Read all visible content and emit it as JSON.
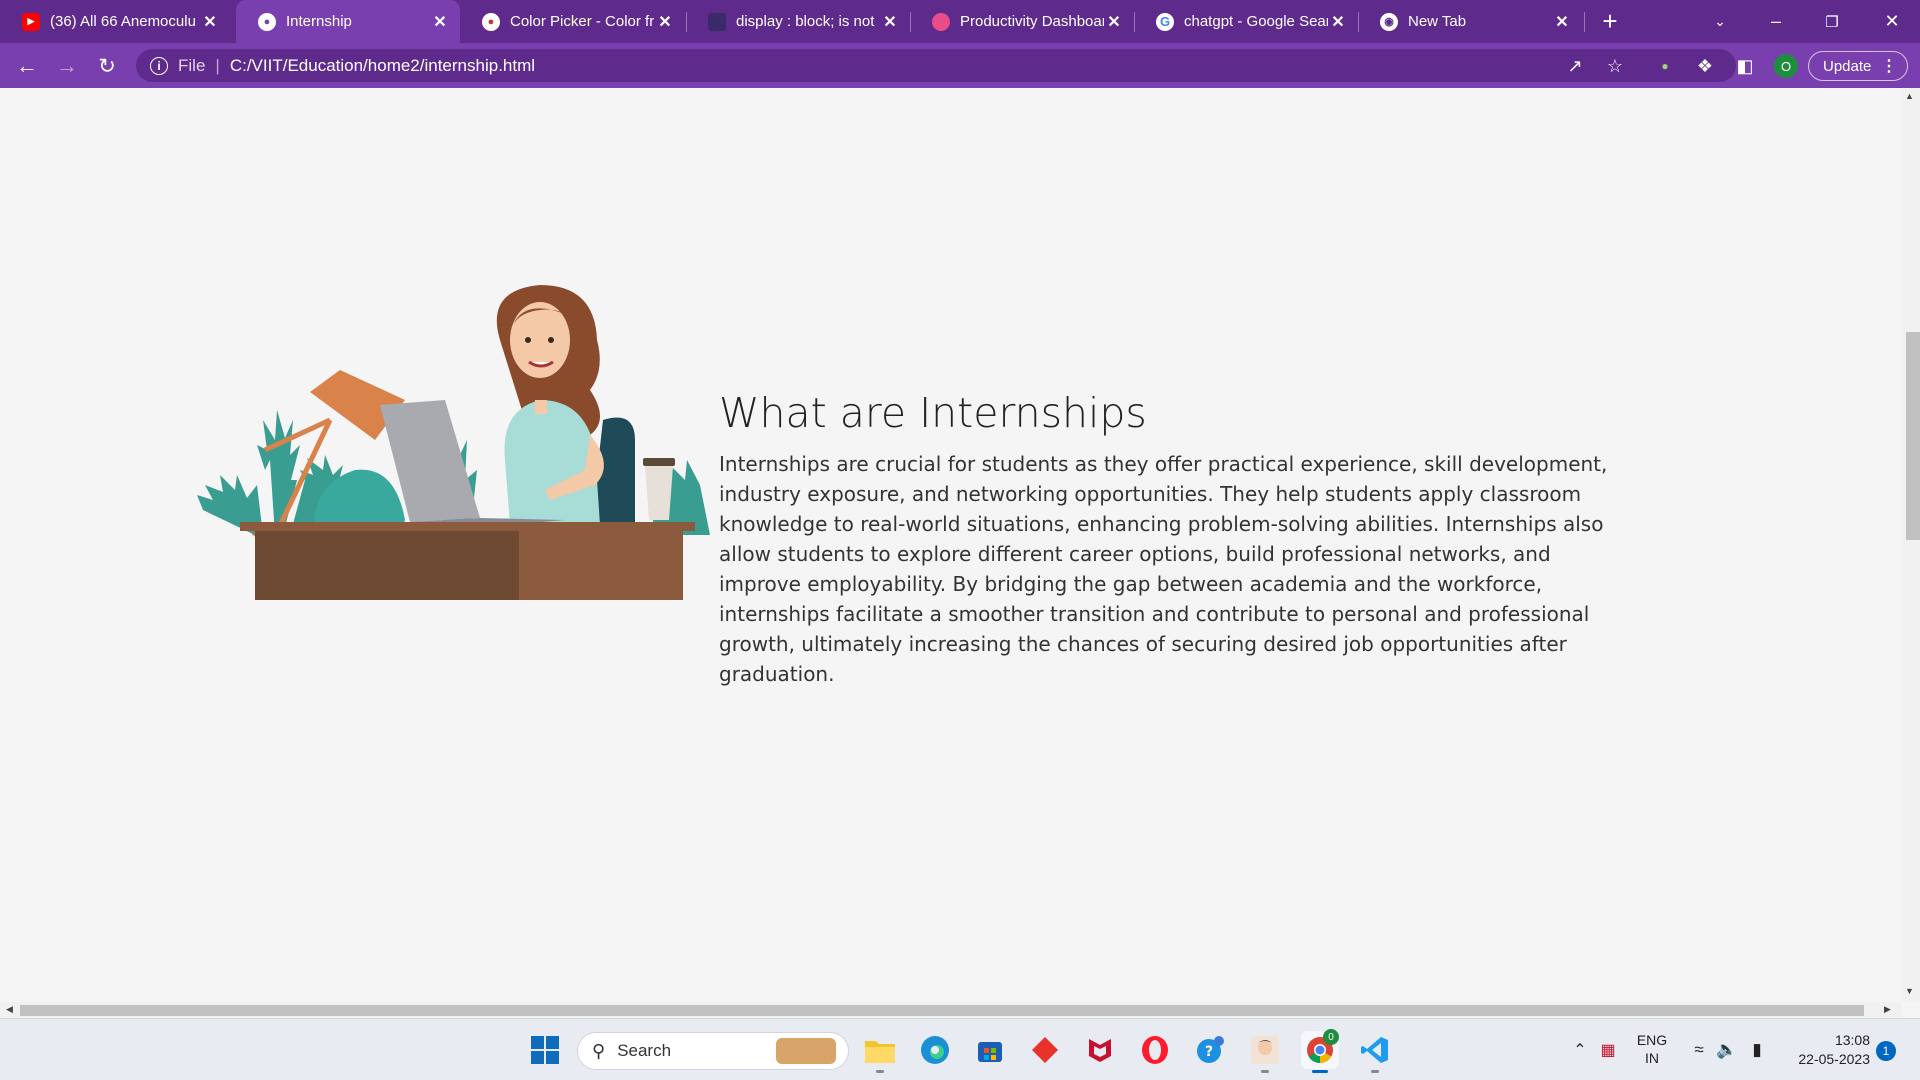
{
  "browser": {
    "tabs": [
      {
        "title": "(36) All 66 Anemoculu",
        "favicon": "youtube-icon"
      },
      {
        "title": "Internship",
        "favicon": "globe-icon"
      },
      {
        "title": "Color Picker - Color fr",
        "favicon": "colorpicker-icon"
      },
      {
        "title": "display : block; is not ",
        "favicon": "generic-icon"
      },
      {
        "title": "Productivity Dashboar",
        "favicon": "dribbble-icon"
      },
      {
        "title": "chatgpt - Google Sear",
        "favicon": "google-icon"
      },
      {
        "title": "New Tab",
        "favicon": "chrome-icon"
      }
    ],
    "active_tab_index": 1,
    "new_tab_symbol": "+",
    "address": {
      "scheme": "File",
      "url": "C:/VIIT/Education/home2/internship.html"
    },
    "profile_initial": "O",
    "update_label": "Update",
    "colors": {
      "tabbar": "#5e2a8c",
      "toolbar": "#7a3fae"
    }
  },
  "page": {
    "heading": "What are Internships",
    "paragraph": "Internships are crucial for students as they offer practical experience, skill development, industry exposure, and networking opportunities. They help students apply classroom knowledge to real-world situations, enhancing problem-solving abilities. Internships also allow students to explore different career options, build professional networks, and improve employability. By bridging the gap between academia and the workforce, internships facilitate a smoother transition and contribute to personal and professional growth, ultimately increasing the chances of securing desired job opportunities after graduation.",
    "illustration": "woman-working-at-desk-illustration"
  },
  "taskbar": {
    "search_placeholder": "Search",
    "apps": [
      "windows-start-icon",
      "search-icon",
      "file-explorer-icon",
      "edge-icon",
      "store-icon",
      "diamond-app-icon",
      "mcafee-icon",
      "opera-icon",
      "skype-icon",
      "avatar-app-icon",
      "chrome-icon",
      "vscode-icon"
    ],
    "chrome_badge": "0",
    "language": {
      "line1": "ENG",
      "line2": "IN"
    },
    "time": "13:08",
    "date": "22-05-2023",
    "notification_count": "1"
  }
}
